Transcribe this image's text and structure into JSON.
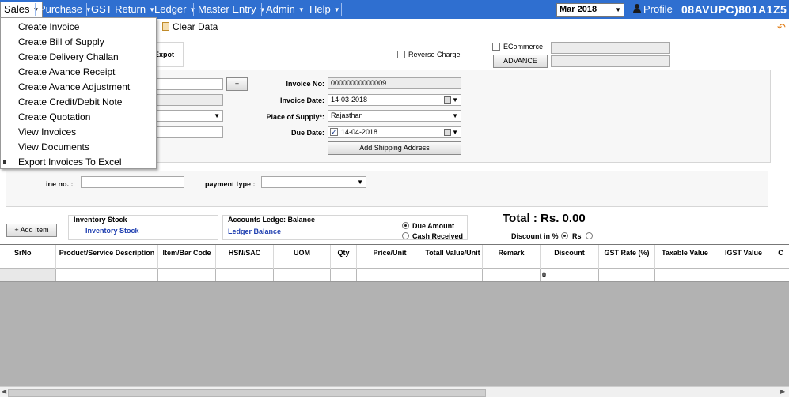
{
  "menubar": {
    "items": [
      {
        "label": "Sales"
      },
      {
        "label": "Purchase"
      },
      {
        "label": "GST Return"
      },
      {
        "label": "Ledger"
      },
      {
        "label": "Master Entry"
      },
      {
        "label": "Admin"
      },
      {
        "label": "Help"
      }
    ],
    "period": "Mar 2018",
    "profile_label": "Profile",
    "gstin": "08AVUPC)801A1Z5"
  },
  "sales_menu": {
    "items": [
      {
        "label": "Create Invoice"
      },
      {
        "label": "Create Bill of Supply"
      },
      {
        "label": "Create Delivery Challan"
      },
      {
        "label": "Create Avance Receipt"
      },
      {
        "label": "Create Avance Adjustment"
      },
      {
        "label": "Create Credit/Debit Note"
      },
      {
        "label": "Create Quotation"
      },
      {
        "label": "View Invoices"
      },
      {
        "label": "View Documents"
      },
      {
        "label": "Export Invoices To Excel"
      }
    ]
  },
  "toolbar": {
    "clear_data": "Clear Data"
  },
  "options": {
    "export_label": "Expot",
    "reverse_charge": "Reverse Charge",
    "ecommerce": "ECommerce",
    "advance": "ADVANCE"
  },
  "invoice": {
    "add_btn": "+",
    "invoice_no_label": "Invoice No:",
    "invoice_no": "00000000000009",
    "invoice_date_label": "Invoice Date:",
    "invoice_date": "14-03-2018",
    "place_label": "Place of Supply*:",
    "place_value": "Rajasthan",
    "due_date_label": "Due Date:",
    "due_date": "14-04-2018",
    "add_shipping": "Add Shipping Address"
  },
  "payment": {
    "line_label": "ine no. :",
    "type_label": "payment type :"
  },
  "summary": {
    "add_item": "+ Add Item",
    "inventory_title": "Inventory Stock",
    "inventory_link": "Inventory Stock",
    "ledger_title": "Accounts Ledge: Balance",
    "ledger_link": "Ledger Balance",
    "due_amount": "Due Amount",
    "cash_received": "Cash Received",
    "total": "Total : Rs. 0.00",
    "discount_label": "Discount in %",
    "rs_label": "Rs"
  },
  "grid": {
    "headers": [
      "SrNo",
      "Product/Service Description",
      "Item/Bar Code",
      "HSN/SAC",
      "UOM",
      "Qty",
      "Price/Unit",
      "Totall Value/Unit",
      "Remark",
      "Discount",
      "GST Rate (%)",
      "Taxable Value",
      "IGST Value",
      "C"
    ],
    "row": {
      "discount": "0"
    }
  }
}
